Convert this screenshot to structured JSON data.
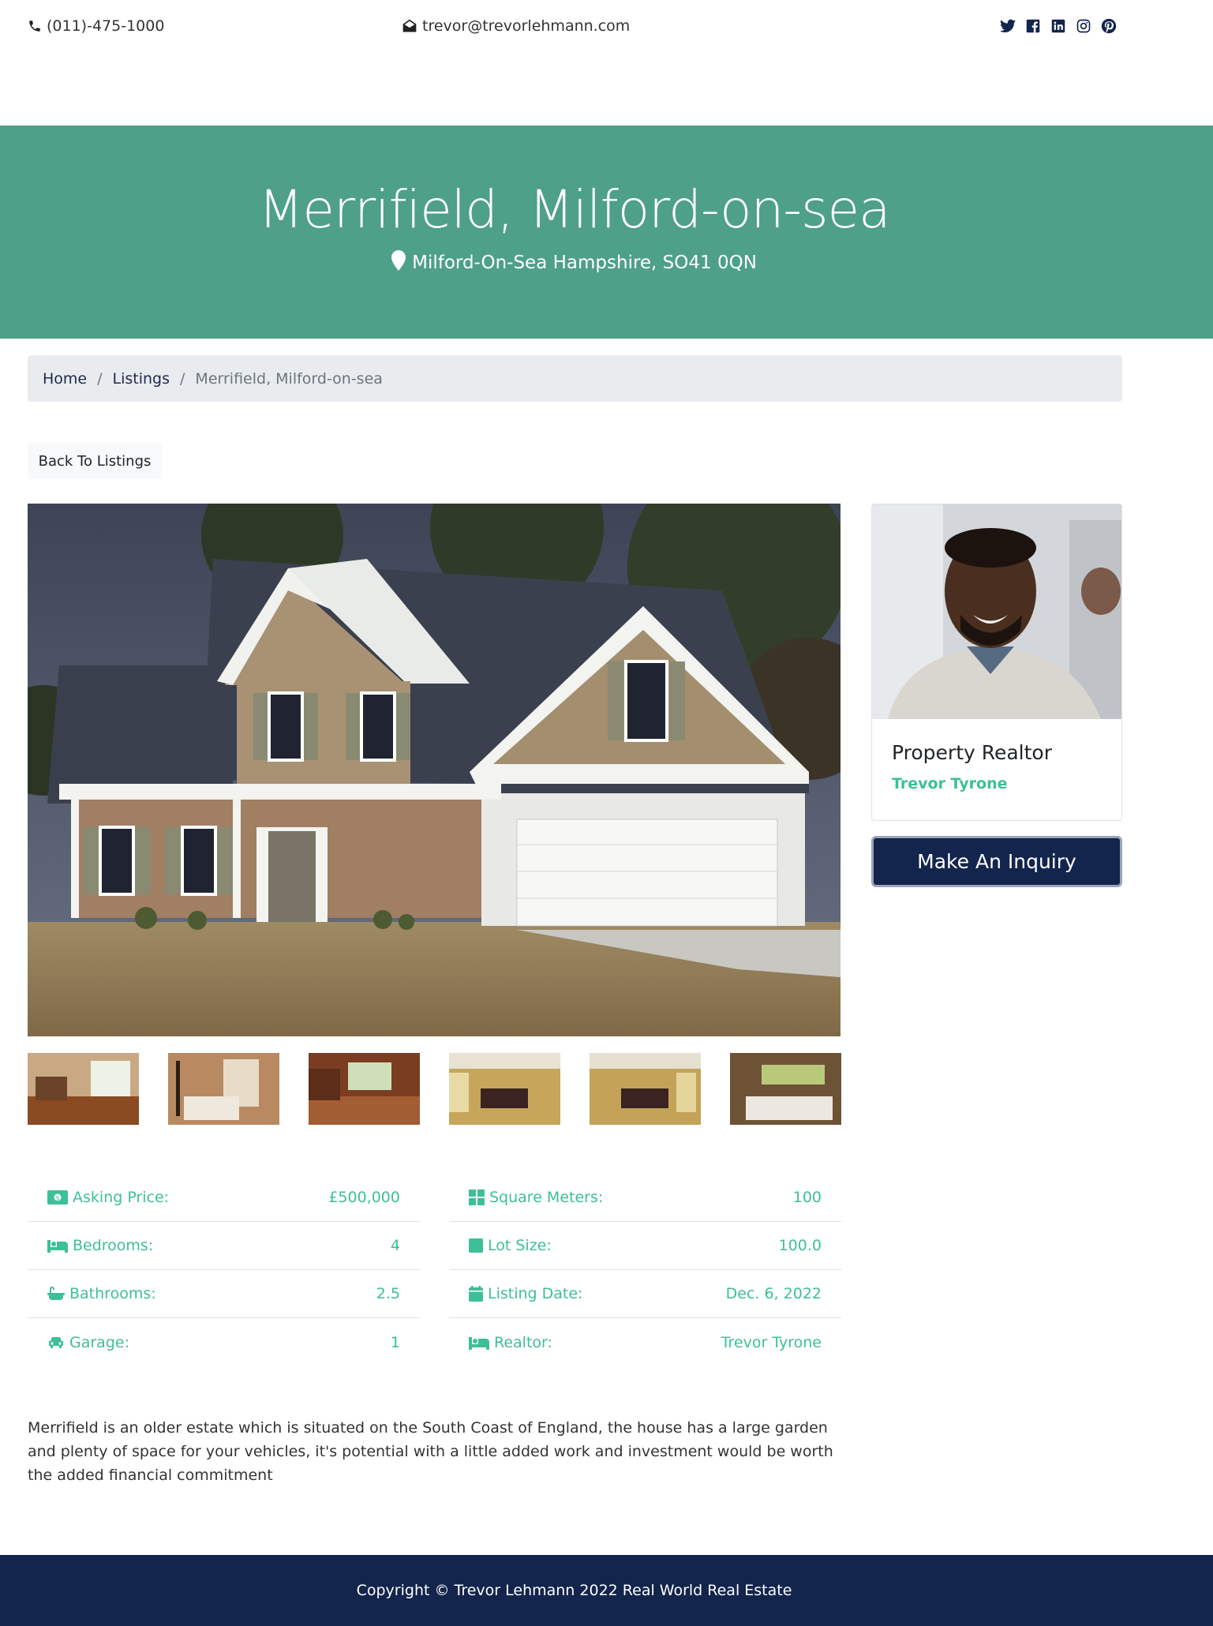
{
  "topbar": {
    "phone": "(011)-475-1000",
    "email": "trevor@trevorlehmann.com",
    "social": [
      "twitter-icon",
      "facebook-icon",
      "linkedin-icon",
      "instagram-icon",
      "pinterest-icon"
    ]
  },
  "hero": {
    "title": "Merrifield, Milford-on-sea",
    "address": "Milford-On-Sea Hampshire, SO41 0QN"
  },
  "breadcrumb": {
    "home": "Home",
    "listings": "Listings",
    "current": "Merrifield, Milford-on-sea",
    "separator": "/"
  },
  "back_button": "Back To Listings",
  "realtor": {
    "title": "Property Realtor",
    "name": "Trevor Tyrone"
  },
  "inquiry_button": "Make An Inquiry",
  "details_left": [
    {
      "icon": "money-icon",
      "label": "Asking Price:",
      "value": "£500,000"
    },
    {
      "icon": "bed-icon",
      "label": "Bedrooms:",
      "value": "4"
    },
    {
      "icon": "bath-icon",
      "label": "Bathrooms:",
      "value": "2.5"
    },
    {
      "icon": "car-icon",
      "label": "Garage:",
      "value": "1"
    }
  ],
  "details_right": [
    {
      "icon": "grid-icon",
      "label": "Square Meters:",
      "value": "100"
    },
    {
      "icon": "square-icon",
      "label": "Lot Size:",
      "value": "100.0"
    },
    {
      "icon": "calendar-icon",
      "label": "Listing Date:",
      "value": "Dec. 6, 2022"
    },
    {
      "icon": "bed-icon",
      "label": "Realtor:",
      "value": "Trevor Tyrone"
    }
  ],
  "description": "Merrifield is an older estate which is situated on the South Coast of England, the house has a large garden and plenty of space for your vehicles, it's potential with a little added work and investment would be worth the added financial commitment",
  "footer": "Copyright © Trevor Lehmann 2022 Real World Real Estate",
  "colors": {
    "hero": "#4ea088",
    "accent": "#3dbf97",
    "navy": "#13244d"
  }
}
